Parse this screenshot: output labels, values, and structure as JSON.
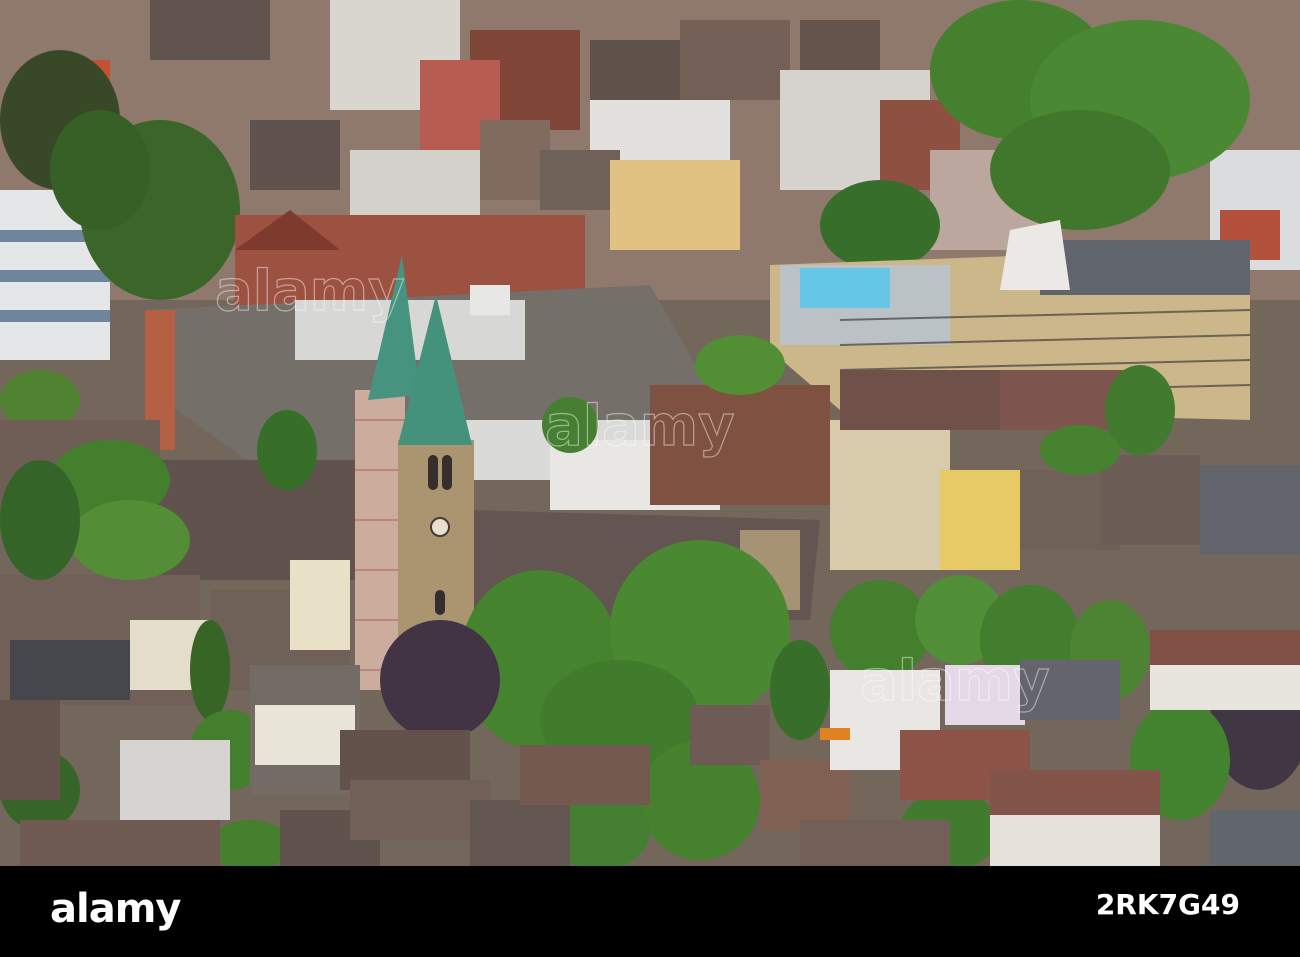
{
  "footer": {
    "brand": "alamy",
    "image_id": "2RK7G49"
  },
  "watermark": {
    "text": "alamy"
  },
  "colors": {
    "footer_bg": "#000000",
    "spire_copper": "#3f8f7a",
    "roof_brown": "#6b4a3e",
    "foliage": "#3f7a2a",
    "flat_roof": "#6f6a63"
  }
}
